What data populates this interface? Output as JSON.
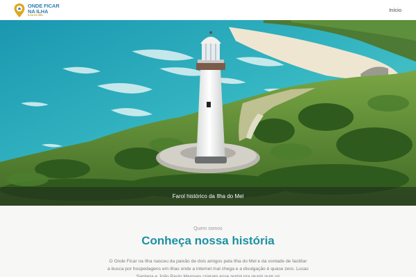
{
  "header": {
    "logo": {
      "line1": "ONDE FICAR",
      "line2": "NA ILHA",
      "tag": "ILHA DO MEL"
    },
    "nav": {
      "home_label": "Início"
    }
  },
  "hero": {
    "caption": "Farol histórico da Ilha do Mel"
  },
  "about": {
    "kicker": "Quem somos",
    "heading": "Conheça nossa história",
    "body": "O Onde Ficar na Ilha nasceu da paixão de dois amigos pela Ilha do Mel e da vontade de facilitar a busca por hospedagens em ilhas onde a internet mal chega e a divulgação é quase zero. Lucas Santana e João Paulo Marques criaram esse portal pra reunir num só"
  },
  "colors": {
    "accent": "#1c90a4",
    "logo_blue": "#2f7fb1",
    "logo_gold": "#e0a623"
  },
  "icons": {
    "logo_pin": "map-pin-icon"
  }
}
